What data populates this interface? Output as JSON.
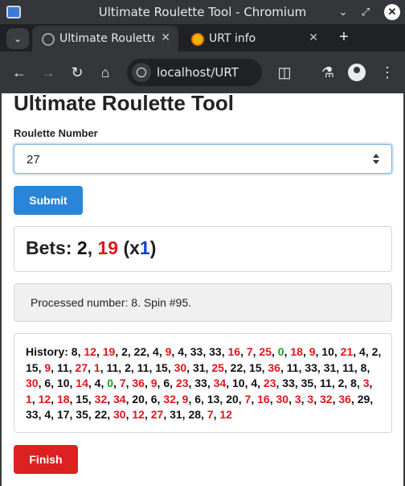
{
  "window": {
    "title": "Ultimate Roulette Tool - Chromium"
  },
  "tabs": [
    {
      "label": "Ultimate Roulette Tool",
      "active": true
    },
    {
      "label": "URT info",
      "active": false
    }
  ],
  "toolbar": {
    "url": "localhost/URT"
  },
  "page": {
    "title": "Ultimate Roulette Tool",
    "input_label": "Roulette Number",
    "input_value": "27",
    "submit_label": "Submit",
    "bets": {
      "prefix": "Bets:",
      "first": "2",
      "separator": ",",
      "second": "19",
      "multiplier_open": "(x",
      "multiplier": "1",
      "multiplier_close": ")"
    },
    "message": "Processed number: 8. Spin #95.",
    "history_label": "History:",
    "history": [
      {
        "n": "8",
        "c": "black"
      },
      {
        "n": "12",
        "c": "red"
      },
      {
        "n": "19",
        "c": "red"
      },
      {
        "n": "2",
        "c": "black"
      },
      {
        "n": "22",
        "c": "black"
      },
      {
        "n": "4",
        "c": "black"
      },
      {
        "n": "9",
        "c": "red"
      },
      {
        "n": "4",
        "c": "black"
      },
      {
        "n": "33",
        "c": "black"
      },
      {
        "n": "33",
        "c": "black"
      },
      {
        "n": "16",
        "c": "red"
      },
      {
        "n": "7",
        "c": "red"
      },
      {
        "n": "25",
        "c": "red"
      },
      {
        "n": "0",
        "c": "green"
      },
      {
        "n": "18",
        "c": "red"
      },
      {
        "n": "9",
        "c": "red"
      },
      {
        "n": "10",
        "c": "black"
      },
      {
        "n": "21",
        "c": "red"
      },
      {
        "n": "4",
        "c": "black"
      },
      {
        "n": "2",
        "c": "black"
      },
      {
        "n": "15",
        "c": "black"
      },
      {
        "n": "9",
        "c": "red"
      },
      {
        "n": "11",
        "c": "black"
      },
      {
        "n": "27",
        "c": "red"
      },
      {
        "n": "1",
        "c": "red"
      },
      {
        "n": "11",
        "c": "black"
      },
      {
        "n": "2",
        "c": "black"
      },
      {
        "n": "11",
        "c": "black"
      },
      {
        "n": "15",
        "c": "black"
      },
      {
        "n": "30",
        "c": "red"
      },
      {
        "n": "31",
        "c": "black"
      },
      {
        "n": "25",
        "c": "red"
      },
      {
        "n": "22",
        "c": "black"
      },
      {
        "n": "15",
        "c": "black"
      },
      {
        "n": "36",
        "c": "red"
      },
      {
        "n": "11",
        "c": "black"
      },
      {
        "n": "33",
        "c": "black"
      },
      {
        "n": "31",
        "c": "black"
      },
      {
        "n": "11",
        "c": "black"
      },
      {
        "n": "8",
        "c": "black"
      },
      {
        "n": "30",
        "c": "red"
      },
      {
        "n": "6",
        "c": "black"
      },
      {
        "n": "10",
        "c": "black"
      },
      {
        "n": "14",
        "c": "red"
      },
      {
        "n": "4",
        "c": "black"
      },
      {
        "n": "0",
        "c": "green"
      },
      {
        "n": "7",
        "c": "red"
      },
      {
        "n": "36",
        "c": "red"
      },
      {
        "n": "9",
        "c": "red"
      },
      {
        "n": "6",
        "c": "black"
      },
      {
        "n": "23",
        "c": "red"
      },
      {
        "n": "33",
        "c": "black"
      },
      {
        "n": "34",
        "c": "red"
      },
      {
        "n": "10",
        "c": "black"
      },
      {
        "n": "4",
        "c": "black"
      },
      {
        "n": "23",
        "c": "red"
      },
      {
        "n": "33",
        "c": "black"
      },
      {
        "n": "35",
        "c": "black"
      },
      {
        "n": "11",
        "c": "black"
      },
      {
        "n": "2",
        "c": "black"
      },
      {
        "n": "8",
        "c": "black"
      },
      {
        "n": "3",
        "c": "red"
      },
      {
        "n": "1",
        "c": "red"
      },
      {
        "n": "12",
        "c": "red"
      },
      {
        "n": "18",
        "c": "red"
      },
      {
        "n": "15",
        "c": "black"
      },
      {
        "n": "32",
        "c": "red"
      },
      {
        "n": "34",
        "c": "red"
      },
      {
        "n": "20",
        "c": "black"
      },
      {
        "n": "6",
        "c": "black"
      },
      {
        "n": "32",
        "c": "red"
      },
      {
        "n": "9",
        "c": "red"
      },
      {
        "n": "6",
        "c": "black"
      },
      {
        "n": "13",
        "c": "black"
      },
      {
        "n": "20",
        "c": "black"
      },
      {
        "n": "7",
        "c": "red"
      },
      {
        "n": "16",
        "c": "red"
      },
      {
        "n": "30",
        "c": "red"
      },
      {
        "n": "3",
        "c": "red"
      },
      {
        "n": "3",
        "c": "red"
      },
      {
        "n": "32",
        "c": "red"
      },
      {
        "n": "36",
        "c": "red"
      },
      {
        "n": "29",
        "c": "black"
      },
      {
        "n": "33",
        "c": "black"
      },
      {
        "n": "4",
        "c": "black"
      },
      {
        "n": "17",
        "c": "black"
      },
      {
        "n": "35",
        "c": "black"
      },
      {
        "n": "22",
        "c": "black"
      },
      {
        "n": "30",
        "c": "red"
      },
      {
        "n": "12",
        "c": "red"
      },
      {
        "n": "27",
        "c": "red"
      },
      {
        "n": "31",
        "c": "black"
      },
      {
        "n": "28",
        "c": "black"
      },
      {
        "n": "7",
        "c": "red"
      },
      {
        "n": "12",
        "c": "red"
      }
    ],
    "finish_label": "Finish"
  },
  "icons": {
    "app": "chromium-app-icon",
    "minimize": "minimize-icon",
    "restore": "restore-icon",
    "close": "close-icon"
  },
  "colors": {
    "red": "#e0161b",
    "black": "#111111",
    "green": "#17a317",
    "blue": "#0d3ed8",
    "submit": "#2a85d8",
    "finish": "#dc2121"
  }
}
